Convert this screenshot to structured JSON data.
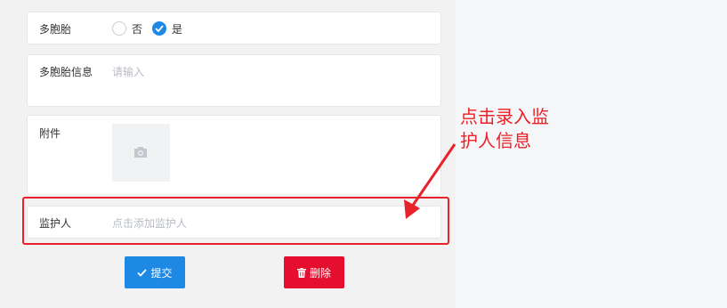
{
  "form": {
    "multiple_birth": {
      "label": "多胞胎",
      "option_no": "否",
      "option_yes": "是",
      "selected": "是"
    },
    "multiple_birth_info": {
      "label": "多胞胎信息",
      "placeholder": "请输入"
    },
    "attachment": {
      "label": "附件",
      "upload_icon": "camera-icon"
    },
    "guardian": {
      "label": "监护人",
      "placeholder": "点击添加监护人"
    }
  },
  "actions": {
    "submit_label": "提交",
    "submit_icon": "check-icon",
    "delete_label": "删除",
    "delete_icon": "trash-icon"
  },
  "annotation": {
    "line1": "点击录入监",
    "line2": "护人信息",
    "color": "#e8222a"
  },
  "colors": {
    "primary": "#1e88e5",
    "danger": "#e60e2f"
  }
}
